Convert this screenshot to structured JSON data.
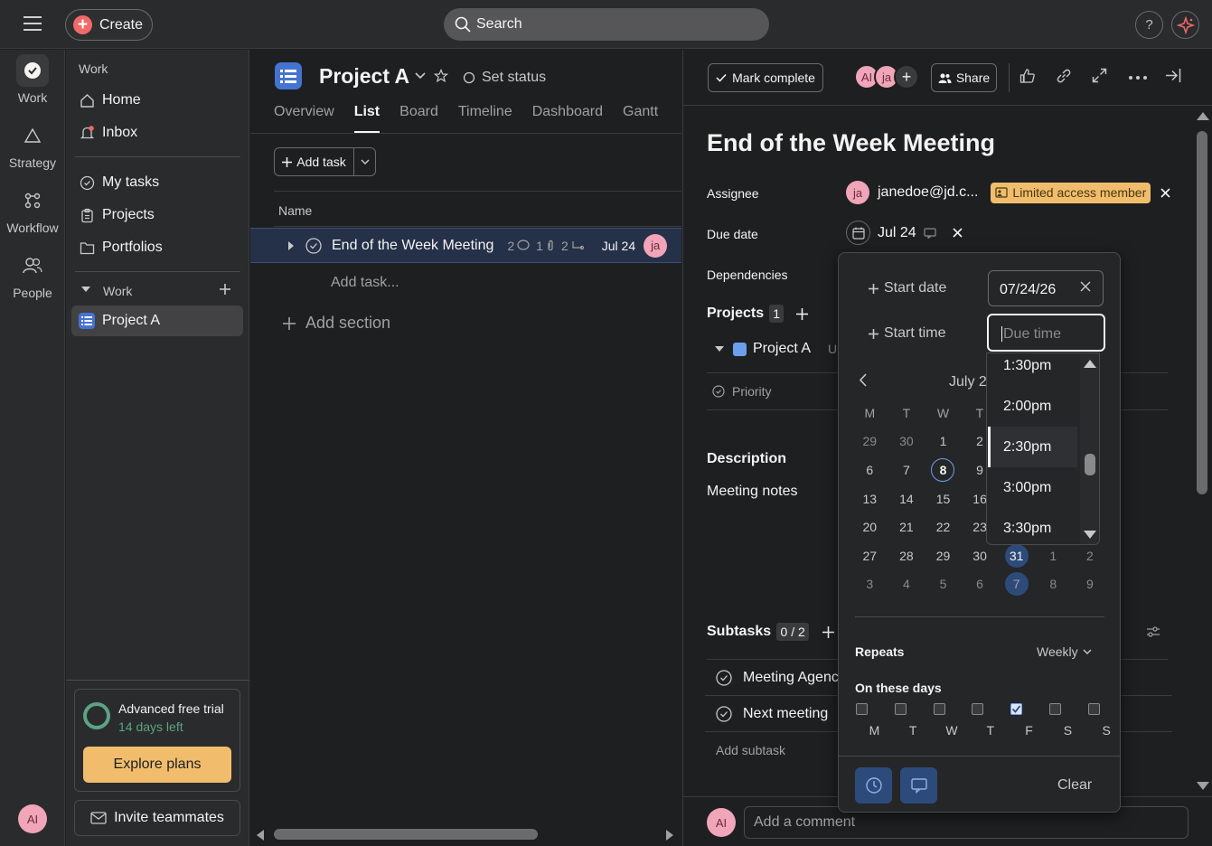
{
  "topbar": {
    "create_label": "Create",
    "search_placeholder": "Search",
    "help_label": "?"
  },
  "rail": {
    "items": [
      {
        "label": "Work",
        "icon": "check-circle-icon"
      },
      {
        "label": "Strategy",
        "icon": "triangle-icon"
      },
      {
        "label": "Workflow",
        "icon": "workflow-icon"
      },
      {
        "label": "People",
        "icon": "people-icon"
      }
    ],
    "avatar": "AI"
  },
  "sidebar": {
    "section1": "Work",
    "home": "Home",
    "inbox": "Inbox",
    "my_tasks": "My tasks",
    "projects": "Projects",
    "portfolios": "Portfolios",
    "section2": "Work",
    "project": "Project A",
    "trial_title": "Advanced free trial",
    "trial_sub": "14 days left",
    "explore": "Explore plans",
    "invite": "Invite teammates"
  },
  "project": {
    "title": "Project A",
    "set_status": "Set status",
    "tabs": [
      "Overview",
      "List",
      "Board",
      "Timeline",
      "Dashboard",
      "Gantt"
    ],
    "active_tab": "List",
    "add_task": "Add task",
    "name_col": "Name",
    "task": {
      "name": "End of the Week Meeting",
      "comments": "2",
      "attachments": "1",
      "subtasks": "2",
      "due": "Jul 24",
      "assignee": "ja"
    },
    "add_task_placeholder": "Add task...",
    "add_section": "Add section"
  },
  "detail": {
    "mark_complete": "Mark complete",
    "collaborators": [
      "AI",
      "ja"
    ],
    "share": "Share",
    "title": "End of the Week Meeting",
    "assignee_label": "Assignee",
    "assignee_avatar": "ja",
    "assignee_name": "janedoe@jd.c...",
    "limited_badge": "Limited access member",
    "due_label": "Due date",
    "due_value": "Jul 24",
    "dependencies_label": "Dependencies",
    "projects_label": "Projects",
    "projects_count": "1",
    "project_name": "Project A",
    "project_section_cut": "U",
    "priority": "Priority",
    "description_label": "Description",
    "description_text": "Meeting notes",
    "subtasks_label": "Subtasks",
    "subtasks_count": "0 / 2",
    "subtasks": [
      "Meeting Agenc",
      "Next meeting"
    ],
    "add_subtask": "Add subtask",
    "comment_avatar": "AI",
    "comment_placeholder": "Add a comment"
  },
  "picker": {
    "start_date_link": "Start date",
    "start_time_link": "Start time",
    "start_date_value": "07/24/26",
    "due_time_placeholder": "Due time",
    "month_label": "July 2",
    "weekday_headers": [
      "M",
      "T",
      "W",
      "T",
      "",
      "",
      ""
    ],
    "weeks": [
      [
        "29",
        "30",
        "1",
        "2",
        "",
        "",
        ""
      ],
      [
        "6",
        "7",
        "8",
        "9",
        "",
        "",
        ""
      ],
      [
        "13",
        "14",
        "15",
        "16",
        "",
        "",
        ""
      ],
      [
        "20",
        "21",
        "22",
        "23",
        "",
        "",
        ""
      ],
      [
        "27",
        "28",
        "29",
        "30",
        "31",
        "1",
        "2"
      ],
      [
        "3",
        "4",
        "5",
        "6",
        "7",
        "8",
        "9"
      ]
    ],
    "today": "8",
    "repeats_label": "Repeats",
    "repeats_value": "Weekly",
    "on_days_label": "On these days",
    "days": [
      {
        "label": "M",
        "checked": false
      },
      {
        "label": "T",
        "checked": false
      },
      {
        "label": "W",
        "checked": false
      },
      {
        "label": "T",
        "checked": false
      },
      {
        "label": "F",
        "checked": true
      },
      {
        "label": "S",
        "checked": false
      },
      {
        "label": "S",
        "checked": false
      }
    ],
    "clear": "Clear",
    "time_options": [
      "1:30pm",
      "2:00pm",
      "2:30pm",
      "3:00pm",
      "3:30pm"
    ],
    "highlighted_time": "2:30pm"
  },
  "colors": {
    "accent_blue": "#4573d2",
    "brand_red": "#f06a6a",
    "badge_yellow": "#f1bd6c",
    "trial_green": "#5da283"
  }
}
